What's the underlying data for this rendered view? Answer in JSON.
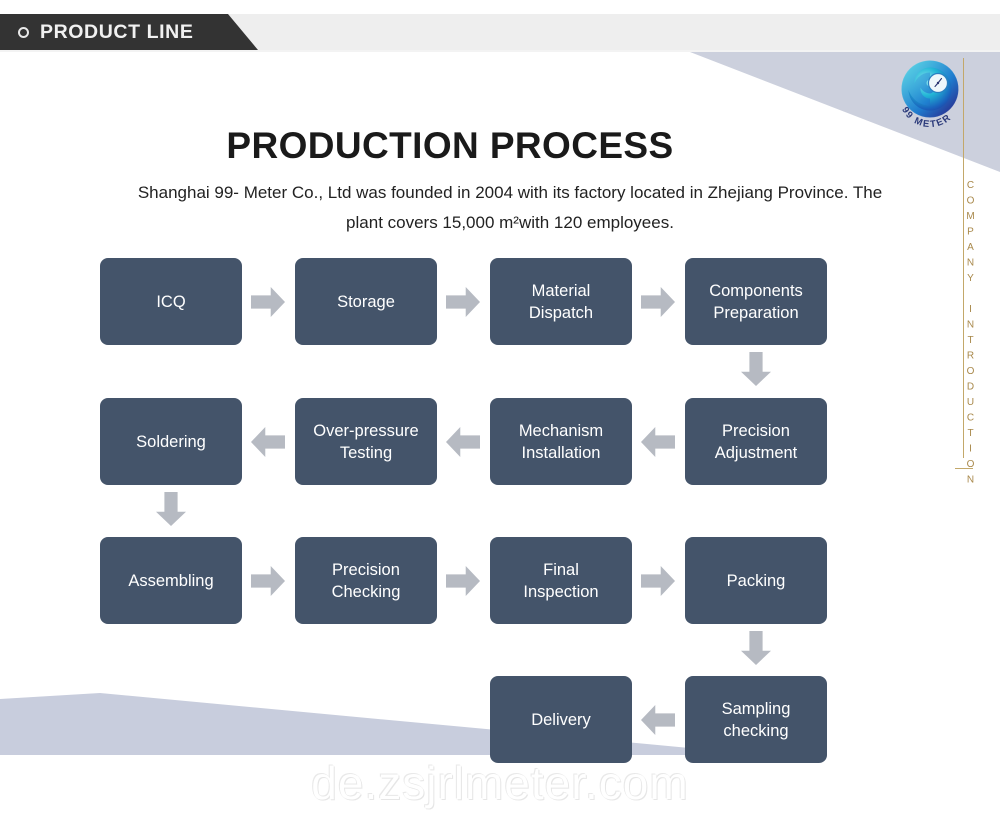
{
  "header": {
    "tab_label": "PRODUCT LINE",
    "tab_icon": "circle-outline-icon",
    "tab_bg": "#333333"
  },
  "rail": {
    "vertical_text": "COMPANY INTRODUCTION",
    "accent_color": "#c3a86a"
  },
  "logo": {
    "name": "99-meter-logo",
    "brand_text": "99 METER",
    "colors": [
      "#1ec8d8",
      "#1b6fc4",
      "#2b2f8f"
    ]
  },
  "content": {
    "title": "PRODUCTION PROCESS",
    "description": "Shanghai 99- Meter Co., Ltd was founded in 2004 with its factory located in Zhejiang Province. The plant covers 15,000 m²with 120 employees."
  },
  "flow": {
    "box_color": "#44546a",
    "arrow_color": "#b6bac2",
    "rows": [
      {
        "direction": "right",
        "steps": [
          {
            "label": "ICQ"
          },
          {
            "label": "Storage"
          },
          {
            "label": "Material\nDispatch",
            "line1": "Material",
            "line2": "Dispatch"
          },
          {
            "label": "Components\nPreparation",
            "line1": "Components",
            "line2": "Preparation"
          }
        ]
      },
      {
        "direction": "left",
        "steps": [
          {
            "label": "Soldering"
          },
          {
            "label": "Over-pressure\nTesting",
            "line1": "Over-pressure",
            "line2": "Testing"
          },
          {
            "label": "Mechanism\nInstallation",
            "line1": "Mechanism",
            "line2": "Installation"
          },
          {
            "label": "Precision\nAdjustment",
            "line1": "Precision",
            "line2": "Adjustment"
          }
        ]
      },
      {
        "direction": "right",
        "steps": [
          {
            "label": "Assembling"
          },
          {
            "label": "Precision\nChecking",
            "line1": "Precision",
            "line2": "Checking"
          },
          {
            "label": "Final\nInspection",
            "line1": "Final",
            "line2": "Inspection"
          },
          {
            "label": "Packing"
          }
        ]
      },
      {
        "direction": "left",
        "steps": [
          {
            "label": "Delivery"
          },
          {
            "label": "Sampling\nchecking",
            "line1": "Sampling",
            "line2": "checking"
          }
        ]
      }
    ],
    "connectors": [
      {
        "type": "down",
        "from": "Components Preparation",
        "to": "Precision Adjustment"
      },
      {
        "type": "down",
        "from": "Soldering",
        "to": "Assembling"
      },
      {
        "type": "down",
        "from": "Packing",
        "to": "Sampling checking"
      }
    ]
  },
  "watermark": {
    "text": "de.zsjrlmeter.com"
  }
}
